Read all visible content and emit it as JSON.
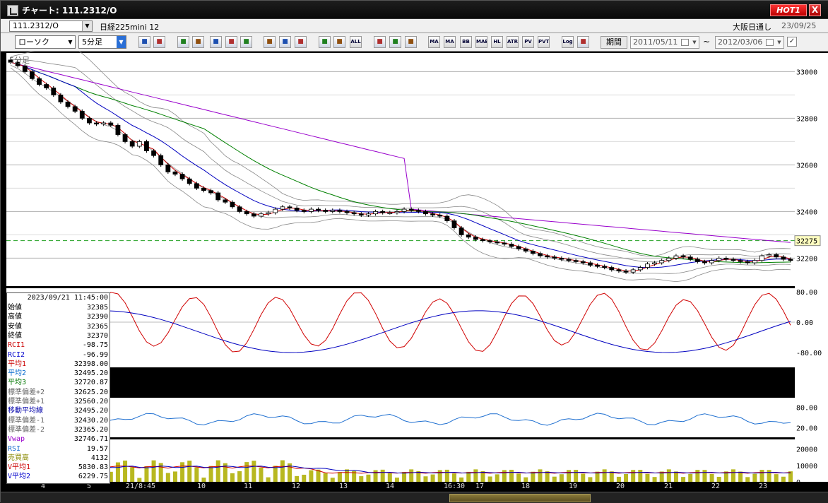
{
  "window": {
    "title": "チャート: 111.2312/O",
    "hot_label": "HOT1",
    "close_label": "X"
  },
  "instrument": {
    "symbol": "111.2312/O",
    "name": "日経225mini 12",
    "market": "大阪日通し",
    "market_date": "23/09/25"
  },
  "toolbar": {
    "chart_type": "ローソク",
    "interval": "5分足",
    "buttons": [
      "search-icon",
      "cursor-icon",
      "chart-icon",
      "zoom-icon",
      "bar-icon",
      "bars-icon",
      "alert-icon",
      "pen-icon",
      "arrow-icon",
      "pointer-icon",
      "candle-icon",
      "candle2-icon",
      "ALL",
      "config-icon",
      "brush-icon",
      "color-icon",
      "MA",
      "MA",
      "BB",
      "MAE",
      "HL",
      "ATR",
      "PV",
      "PVT",
      "Log",
      "export-icon"
    ],
    "period_label": "期間",
    "date_from": "2011/05/11",
    "date_to": "2012/03/06",
    "tilde": "~"
  },
  "chart_label": "5分足",
  "colors": {
    "candle_up": "#ffffff",
    "candle_down": "#000000",
    "ma1": "#d00000",
    "ma2": "#0000c0",
    "ma3": "#008000",
    "vwap": "#9900cc",
    "band": "#888888",
    "rci1": "#d00000",
    "rci2": "#0000c0",
    "rsi": "#1e6fd0",
    "volume": "#b8b820"
  },
  "price_axis": {
    "ticks": [
      "33000",
      "32800",
      "32600",
      "32400",
      "32200"
    ],
    "current": "32275"
  },
  "rci_axis": [
    "80.00",
    "0.00",
    "-80.00"
  ],
  "rsi_axis": [
    "80.00",
    "20.00"
  ],
  "volume_axis": [
    "20000",
    "10000",
    "0"
  ],
  "time_axis": [
    "4",
    "5",
    "21/8:45",
    "10",
    "11",
    "12",
    "13",
    "14",
    "16:30",
    "17",
    "18",
    "19",
    "20",
    "21",
    "22",
    "23"
  ],
  "info": {
    "datetime": "2023/09/21 11:45:00",
    "rows": [
      {
        "label": "始値",
        "value": "32385",
        "color": "#000000"
      },
      {
        "label": "高値",
        "value": "32390",
        "color": "#000000"
      },
      {
        "label": "安値",
        "value": "32365",
        "color": "#000000"
      },
      {
        "label": "終値",
        "value": "32370",
        "color": "#000000"
      },
      {
        "label": "RCI1",
        "value": "-98.75",
        "color": "#cc0000"
      },
      {
        "label": "RCI2",
        "value": "-96.99",
        "color": "#0000cc"
      },
      {
        "label": "平均1",
        "value": "32398.00",
        "color": "#cc0000"
      },
      {
        "label": "平均2",
        "value": "32495.20",
        "color": "#0066cc"
      },
      {
        "label": "平均3",
        "value": "32720.87",
        "color": "#007700"
      },
      {
        "label": "標準偏差+2",
        "value": "32625.20",
        "color": "#666666"
      },
      {
        "label": "標準偏差+1",
        "value": "32560.20",
        "color": "#666666"
      },
      {
        "label": "移動平均線",
        "value": "32495.20",
        "color": "#0000aa"
      },
      {
        "label": "標準偏差-1",
        "value": "32430.20",
        "color": "#666666"
      },
      {
        "label": "標準偏差-2",
        "value": "32365.20",
        "color": "#666666"
      },
      {
        "label": "Vwap",
        "value": "32746.71",
        "color": "#9900cc"
      },
      {
        "label": "RSI",
        "value": "19.57",
        "color": "#1e6fd0"
      },
      {
        "label": "売買高",
        "value": "4132",
        "color": "#888800"
      },
      {
        "label": "V平均1",
        "value": "5830.83",
        "color": "#cc0000"
      },
      {
        "label": "V平均2",
        "value": "6229.75",
        "color": "#0000cc"
      }
    ]
  },
  "chart_data": {
    "type": "line",
    "price_ylim": [
      32080,
      33080
    ],
    "close_series": [
      33040,
      33025,
      33000,
      32970,
      32945,
      32930,
      32900,
      32870,
      32850,
      32830,
      32800,
      32780,
      32775,
      32780,
      32770,
      32730,
      32700,
      32680,
      32700,
      32660,
      32640,
      32600,
      32570,
      32560,
      32540,
      32520,
      32500,
      32490,
      32480,
      32450,
      32440,
      32420,
      32400,
      32390,
      32380,
      32390,
      32395,
      32410,
      32420,
      32415,
      32405,
      32400,
      32410,
      32405,
      32400,
      32405,
      32400,
      32395,
      32390,
      32385,
      32390,
      32400,
      32395,
      32395,
      32400,
      32410,
      32405,
      32400,
      32390,
      32385,
      32380,
      32360,
      32330,
      32300,
      32290,
      32280,
      32275,
      32270,
      32265,
      32260,
      32250,
      32240,
      32230,
      32220,
      32210,
      32205,
      32200,
      32195,
      32190,
      32185,
      32180,
      32170,
      32165,
      32160,
      32150,
      32145,
      32140,
      32150,
      32160,
      32175,
      32180,
      32190,
      32200,
      32210,
      32205,
      32195,
      32185,
      32180,
      32190,
      32200,
      32195,
      32190,
      32185,
      32180,
      32190,
      32210,
      32215,
      32205,
      32195,
      32190
    ]
  }
}
